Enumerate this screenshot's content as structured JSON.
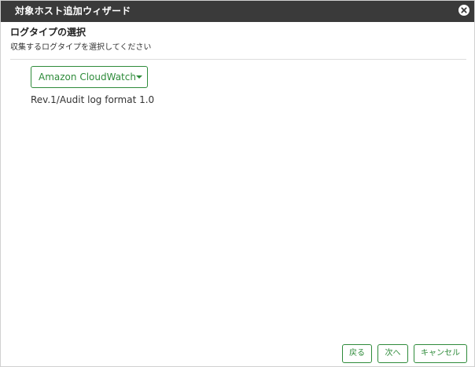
{
  "dialog": {
    "title": "対象ホスト追加ウィザード"
  },
  "section": {
    "title": "ログタイプの選択",
    "description": "収集するログタイプを選択してください"
  },
  "log_type": {
    "selected": "Amazon CloudWatch",
    "format": "Rev.1/Audit log format 1.0"
  },
  "footer": {
    "back_label": "戻る",
    "next_label": "次へ",
    "cancel_label": "キャンセル"
  },
  "colors": {
    "accent": "#2e8b3a",
    "titlebar": "#3a3a3a"
  },
  "icons": {
    "close": "close-icon",
    "dropdown": "caret-down-icon"
  }
}
